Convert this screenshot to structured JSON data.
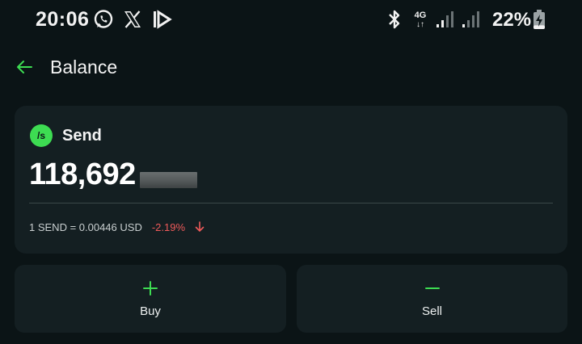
{
  "status_bar": {
    "time": "20:06",
    "notification_icons": [
      "whatsapp-icon",
      "x-icon",
      "app-icon"
    ],
    "system_icons": [
      "bluetooth-icon",
      "4g-icon",
      "signal-icon",
      "signal-icon"
    ],
    "network_label": "4G",
    "battery_percent": "22%",
    "battery_level": 0.22
  },
  "header": {
    "back_icon": "arrow-left-icon",
    "title": "Balance"
  },
  "balance_card": {
    "token_logo_text": "/s",
    "token_name": "Send",
    "amount": "118,692",
    "price": "1 SEND = 0.00446 USD",
    "change": "-2.19%",
    "change_icon": "arrow-down-icon"
  },
  "actions": {
    "buy_label": "Buy",
    "sell_label": "Sell"
  },
  "colors": {
    "background": "#0b1416",
    "card": "#141f22",
    "accent": "#3ddc52",
    "negative": "#ef5a5a"
  }
}
